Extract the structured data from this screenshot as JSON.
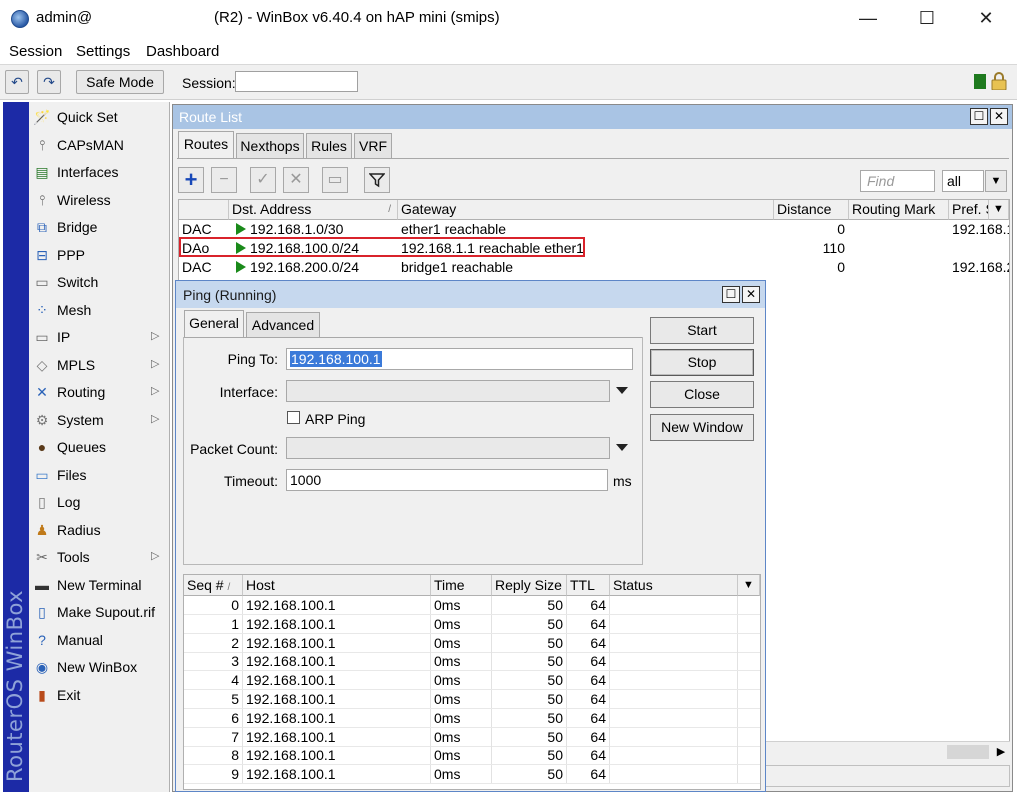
{
  "window": {
    "title_left": "admin@",
    "title_main": "(R2) - WinBox v6.40.4 on hAP mini (smips)",
    "controls": [
      "—",
      "☐",
      "✕"
    ]
  },
  "menubar": [
    "Session",
    "Settings",
    "Dashboard"
  ],
  "toolbar": {
    "undo_icon": "↶",
    "redo_icon": "↷",
    "safe_mode_label": "Safe Mode",
    "session_label": "Session:",
    "session_value": ""
  },
  "brand": "RouterOS WinBox",
  "sidebar": {
    "items": [
      {
        "label": "Quick Set",
        "icon": "🪄",
        "arrow": ""
      },
      {
        "label": "CAPsMAN",
        "icon": "⫯",
        "arrow": ""
      },
      {
        "label": "Interfaces",
        "icon": "▤",
        "arrow": ""
      },
      {
        "label": "Wireless",
        "icon": "⫯",
        "arrow": ""
      },
      {
        "label": "Bridge",
        "icon": "⧉",
        "arrow": ""
      },
      {
        "label": "PPP",
        "icon": "⊟",
        "arrow": ""
      },
      {
        "label": "Switch",
        "icon": "▭",
        "arrow": ""
      },
      {
        "label": "Mesh",
        "icon": "⁘",
        "arrow": ""
      },
      {
        "label": "IP",
        "icon": "▭",
        "arrow": "▷"
      },
      {
        "label": "MPLS",
        "icon": "◇",
        "arrow": "▷"
      },
      {
        "label": "Routing",
        "icon": "✕",
        "arrow": "▷"
      },
      {
        "label": "System",
        "icon": "⚙",
        "arrow": "▷"
      },
      {
        "label": "Queues",
        "icon": "●",
        "arrow": ""
      },
      {
        "label": "Files",
        "icon": "▭",
        "arrow": ""
      },
      {
        "label": "Log",
        "icon": "▯",
        "arrow": ""
      },
      {
        "label": "Radius",
        "icon": "♟",
        "arrow": ""
      },
      {
        "label": "Tools",
        "icon": "✂",
        "arrow": "▷"
      },
      {
        "label": "New Terminal",
        "icon": "▬",
        "arrow": ""
      },
      {
        "label": "Make Supout.rif",
        "icon": "▯",
        "arrow": ""
      },
      {
        "label": "Manual",
        "icon": "?",
        "arrow": ""
      },
      {
        "label": "New WinBox",
        "icon": "◉",
        "arrow": ""
      },
      {
        "label": "Exit",
        "icon": "▮",
        "arrow": ""
      }
    ]
  },
  "route_list": {
    "title": "Route List",
    "tabs": [
      "Routes",
      "Nexthops",
      "Rules",
      "VRF"
    ],
    "find_placeholder": "Find",
    "filter_value": "all",
    "columns": [
      "",
      "Dst. Address",
      "Gateway",
      "Distance",
      "Routing Mark",
      "Pref. S"
    ],
    "sort_marker": "/",
    "rows": [
      {
        "flags": "DAC",
        "dst": "192.168.1.0/30",
        "gateway": "ether1 reachable",
        "distance": "0",
        "mark": "",
        "pref": "192.168.1"
      },
      {
        "flags": "DAo",
        "dst": "192.168.100.0/24",
        "gateway": "192.168.1.1 reachable ether1",
        "distance": "110",
        "mark": "",
        "pref": ""
      },
      {
        "flags": "DAC",
        "dst": "192.168.200.0/24",
        "gateway": "bridge1 reachable",
        "distance": "0",
        "mark": "",
        "pref": "192.168.2"
      }
    ]
  },
  "ping": {
    "title": "Ping (Running)",
    "tabs": [
      "General",
      "Advanced"
    ],
    "ping_to_label": "Ping To:",
    "ping_to_value": "192.168.100.1",
    "interface_label": "Interface:",
    "interface_value": "",
    "arp_ping_label": "ARP Ping",
    "packet_count_label": "Packet Count:",
    "packet_count_value": "",
    "timeout_label": "Timeout:",
    "timeout_value": "1000",
    "timeout_unit": "ms",
    "buttons": [
      "Start",
      "Stop",
      "Close",
      "New Window"
    ],
    "columns": [
      "Seq #",
      "Host",
      "Time",
      "Reply Size",
      "TTL",
      "Status"
    ],
    "sort_marker": "/",
    "results": [
      {
        "seq": "0",
        "host": "192.168.100.1",
        "time": "0ms",
        "size": "50",
        "ttl": "64",
        "status": ""
      },
      {
        "seq": "1",
        "host": "192.168.100.1",
        "time": "0ms",
        "size": "50",
        "ttl": "64",
        "status": ""
      },
      {
        "seq": "2",
        "host": "192.168.100.1",
        "time": "0ms",
        "size": "50",
        "ttl": "64",
        "status": ""
      },
      {
        "seq": "3",
        "host": "192.168.100.1",
        "time": "0ms",
        "size": "50",
        "ttl": "64",
        "status": ""
      },
      {
        "seq": "4",
        "host": "192.168.100.1",
        "time": "0ms",
        "size": "50",
        "ttl": "64",
        "status": ""
      },
      {
        "seq": "5",
        "host": "192.168.100.1",
        "time": "0ms",
        "size": "50",
        "ttl": "64",
        "status": ""
      },
      {
        "seq": "6",
        "host": "192.168.100.1",
        "time": "0ms",
        "size": "50",
        "ttl": "64",
        "status": ""
      },
      {
        "seq": "7",
        "host": "192.168.100.1",
        "time": "0ms",
        "size": "50",
        "ttl": "64",
        "status": ""
      },
      {
        "seq": "8",
        "host": "192.168.100.1",
        "time": "0ms",
        "size": "50",
        "ttl": "64",
        "status": ""
      },
      {
        "seq": "9",
        "host": "192.168.100.1",
        "time": "0ms",
        "size": "50",
        "ttl": "64",
        "status": ""
      }
    ]
  },
  "colors": {
    "brand_bar": "#1c2aa6",
    "route_list_title_bg": "#a9c4e4",
    "ping_title_bg": "#c6d8ee",
    "highlight_box": "#d9232b",
    "route_active_flag": "#1a8a1a",
    "selection": "#3b7ad9"
  }
}
